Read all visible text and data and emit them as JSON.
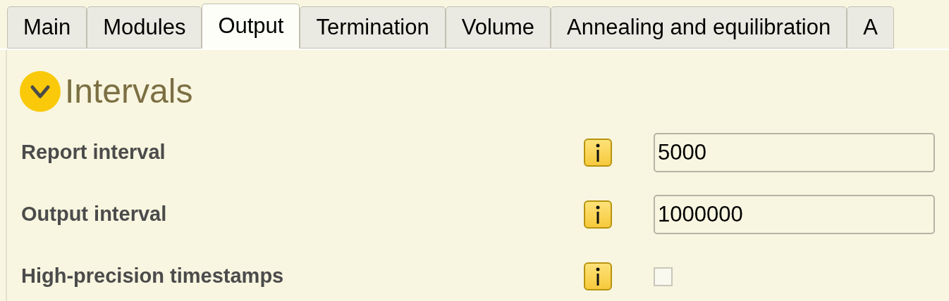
{
  "tabs": [
    {
      "label": "Main",
      "selected": false
    },
    {
      "label": "Modules",
      "selected": false
    },
    {
      "label": "Output",
      "selected": true
    },
    {
      "label": "Termination",
      "selected": false
    },
    {
      "label": "Volume",
      "selected": false
    },
    {
      "label": "Annealing and equilibration",
      "selected": false
    },
    {
      "label": "A",
      "selected": false
    }
  ],
  "section": {
    "title": "Intervals",
    "expanded": true
  },
  "fields": [
    {
      "kind": "text",
      "label": "Report interval",
      "value": "5000"
    },
    {
      "kind": "text",
      "label": "Output interval",
      "value": "1000000"
    },
    {
      "kind": "checkbox",
      "label": "High-precision timestamps",
      "checked": false
    }
  ]
}
